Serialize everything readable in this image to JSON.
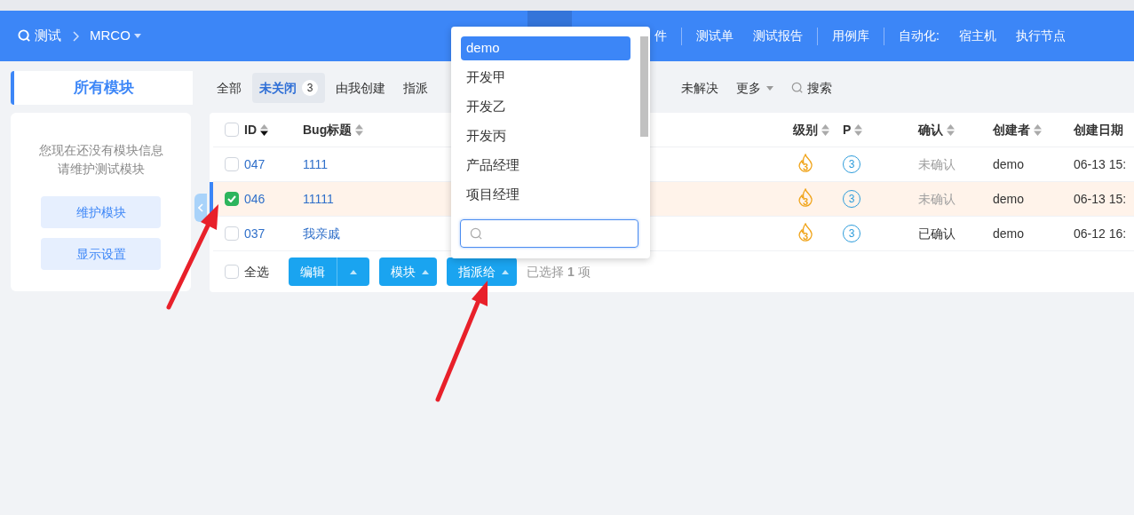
{
  "header": {
    "product": "测试",
    "project": "MRCO",
    "nav_groups": [
      [
        "件"
      ],
      [
        "测试单",
        "测试报告"
      ],
      [
        "用例库"
      ],
      [
        "自动化:",
        "宿主机",
        "执行节点"
      ]
    ]
  },
  "sidebar": {
    "title": "所有模块",
    "message": [
      "您现在还没有模块信息",
      "请维护测试模块"
    ],
    "buttons": [
      "维护模块",
      "显示设置"
    ]
  },
  "tabs": [
    {
      "label": "全部",
      "selected": false
    },
    {
      "label": "未关闭",
      "selected": true,
      "count": "3"
    },
    {
      "label": "由我创建",
      "selected": false
    },
    {
      "label": "指派",
      "selected": false
    }
  ],
  "tabs_right": {
    "items": [
      "未解决"
    ],
    "more": "更多",
    "search": "搜索"
  },
  "table": {
    "select_all_checked": false,
    "columns": [
      {
        "label": "ID",
        "sorted_desc": true
      },
      {
        "label": "Bug标题",
        "sorted_desc": false
      },
      {
        "label": "级别",
        "sorted_desc": false
      },
      {
        "label": "P",
        "sorted_desc": false
      },
      {
        "label": "确认",
        "sorted_desc": false
      },
      {
        "label": "创建者",
        "sorted_desc": false
      },
      {
        "label": "创建日期"
      }
    ],
    "rows": [
      {
        "checked": false,
        "id": "047",
        "title": "1111",
        "severity": "3",
        "priority": "3",
        "confirm": "未确认",
        "confirmed": false,
        "creator": "demo",
        "date": "06-13 15:"
      },
      {
        "checked": true,
        "id": "046",
        "title": "11111",
        "severity": "3",
        "priority": "3",
        "confirm": "未确认",
        "confirmed": false,
        "creator": "demo",
        "date": "06-13 15:"
      },
      {
        "checked": false,
        "id": "037",
        "title": "我亲戚",
        "severity": "3",
        "priority": "3",
        "confirm": "已确认",
        "confirmed": true,
        "creator": "demo",
        "date": "06-12 16:"
      }
    ]
  },
  "footer": {
    "select_all": "全选",
    "checked": false,
    "buttons": [
      {
        "label": "编辑",
        "split": true
      },
      {
        "label": "模块",
        "split": false
      },
      {
        "label": "指派给",
        "split": false
      }
    ],
    "selection": "已选择 **1** 项"
  },
  "dropdown": {
    "items": [
      {
        "label": "demo",
        "selected": true
      },
      {
        "label": "开发甲",
        "selected": false
      },
      {
        "label": "开发乙",
        "selected": false
      },
      {
        "label": "开发丙",
        "selected": false
      },
      {
        "label": "产品经理",
        "selected": false
      },
      {
        "label": "项目经理",
        "selected": false
      }
    ]
  }
}
